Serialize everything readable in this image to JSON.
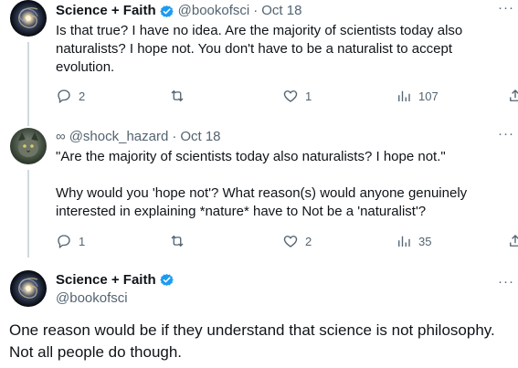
{
  "tweets": [
    {
      "name": "Science + Faith",
      "handle": "@bookofsci",
      "date": "Oct 18",
      "text": "Is that true? I have no idea. Are the majority of scientists today also\nnaturalists? I hope not. You don't have to be a naturalist to accept\nevolution.",
      "replies": "2",
      "retweets": "",
      "likes": "1",
      "views": "107"
    },
    {
      "name_prefix": "∞",
      "handle": "@shock_hazard",
      "date": "Oct 18",
      "text": "\"Are the majority of scientists today also naturalists? I hope not.\"\n\nWhy would you 'hope not'? What reason(s) would anyone genuinely\ninterested in explaining *nature* have to Not be a 'naturalist'?",
      "replies": "1",
      "retweets": "",
      "likes": "2",
      "views": "35"
    }
  ],
  "main": {
    "name": "Science + Faith",
    "handle": "@bookofsci",
    "text": "One reason would be if they understand that science is not philosophy.\nNot all people do though."
  },
  "more_label": "···",
  "dot": "·",
  "colors": {
    "verified": "#1d9bf0",
    "muted": "#536471",
    "thread_line": "#cfd9de"
  },
  "icons": [
    "verified-badge-icon",
    "reply-icon",
    "retweet-icon",
    "like-icon",
    "views-icon",
    "share-icon",
    "more-icon"
  ]
}
